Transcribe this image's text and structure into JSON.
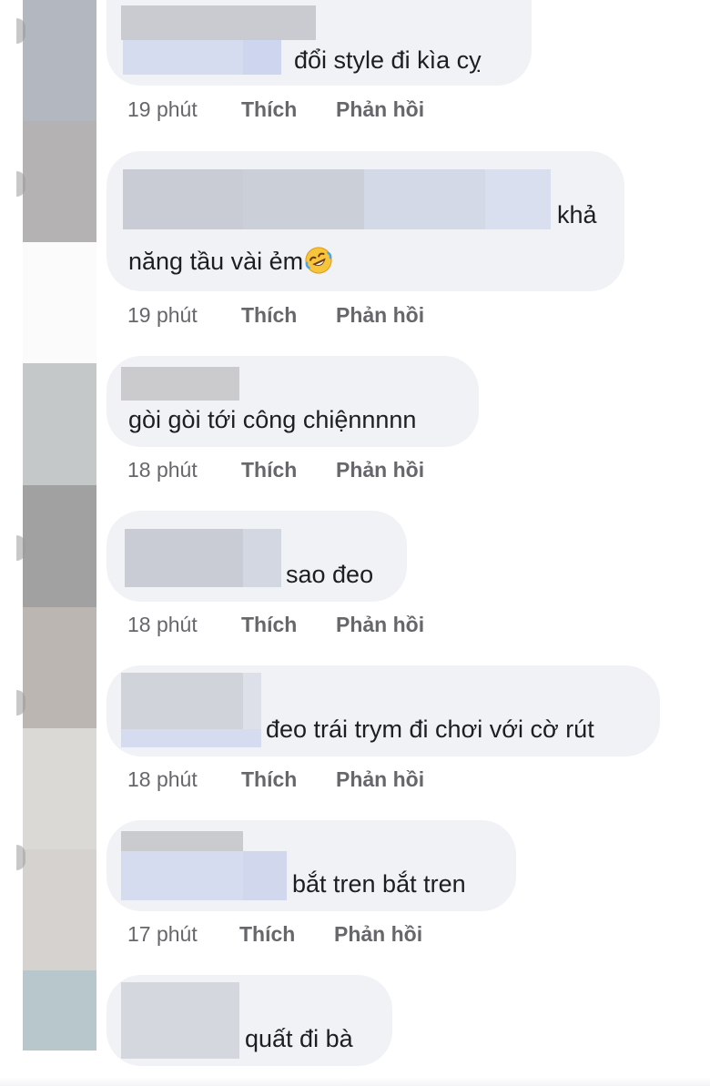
{
  "comments": [
    {
      "text": "đổi style đi kìa cỵ",
      "time": "19 phút",
      "like": "Thích",
      "reply": "Phản hồi"
    },
    {
      "text_line1": "khả",
      "text_line2": "năng tầu vài ẻm",
      "time": "19 phút",
      "like": "Thích",
      "reply": "Phản hồi"
    },
    {
      "text": "gòi gòi tới công chiệnnnnn",
      "time": "18 phút",
      "like": "Thích",
      "reply": "Phản hồi"
    },
    {
      "text": "sao đeo",
      "time": "18 phút",
      "like": "Thích",
      "reply": "Phản hồi"
    },
    {
      "text": "đeo trái trym đi chơi với cờ rút",
      "time": "18 phút",
      "like": "Thích",
      "reply": "Phản hồi"
    },
    {
      "text": "bắt tren bắt tren",
      "time": "17 phút",
      "like": "Thích",
      "reply": "Phản hồi"
    },
    {
      "text": "quất đi bà"
    }
  ],
  "emoji": "rolling-on-floor-laughing-emoji",
  "colors": {
    "bubble": "#f0f2f5",
    "meta_text": "#65676b",
    "comment_text": "#1c1e21",
    "redaction_gray": "#c9ccd4",
    "redaction_blue": "#d3daf0"
  }
}
